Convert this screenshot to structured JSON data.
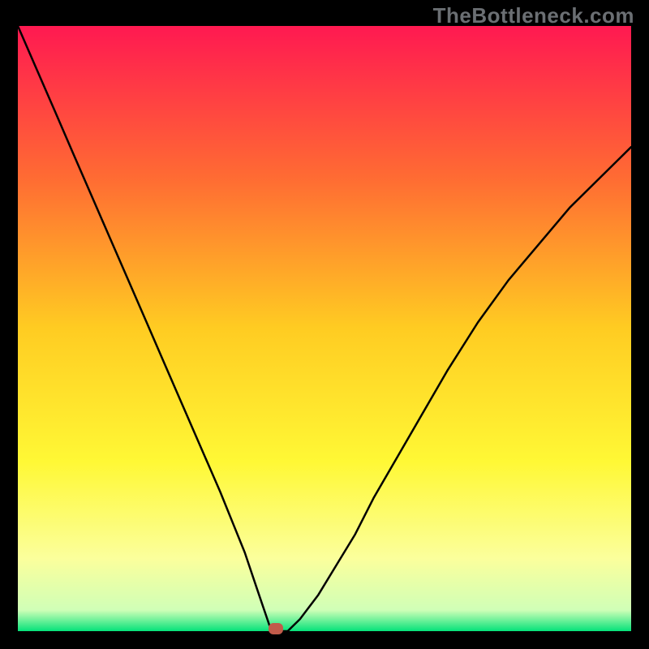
{
  "watermark": "TheBottleneck.com",
  "chart_data": {
    "type": "line",
    "title": "",
    "xlabel": "",
    "ylabel": "",
    "xlim": [
      0,
      100
    ],
    "ylim": [
      0,
      100
    ],
    "grid": false,
    "marker": {
      "x": 42,
      "y": 0,
      "color": "#c25b4a"
    },
    "background_gradient": [
      {
        "pos": 0.0,
        "color": "#ff1951"
      },
      {
        "pos": 0.25,
        "color": "#ff6b33"
      },
      {
        "pos": 0.5,
        "color": "#ffcc22"
      },
      {
        "pos": 0.72,
        "color": "#fff835"
      },
      {
        "pos": 0.88,
        "color": "#fbff9c"
      },
      {
        "pos": 0.965,
        "color": "#d0ffb7"
      },
      {
        "pos": 1.0,
        "color": "#05e27a"
      }
    ],
    "series": [
      {
        "name": "curve",
        "x": [
          0,
          3,
          6,
          9,
          12,
          15,
          18,
          21,
          24,
          27,
          30,
          33,
          35,
          37,
          39,
          40,
          41,
          42,
          43,
          44,
          46,
          49,
          52,
          55,
          58,
          62,
          66,
          70,
          75,
          80,
          85,
          90,
          95,
          100
        ],
        "y": [
          100,
          93,
          86,
          79,
          72,
          65,
          58,
          51,
          44,
          37,
          30,
          23,
          18,
          13,
          7,
          4,
          1,
          0,
          0,
          0,
          2,
          6,
          11,
          16,
          22,
          29,
          36,
          43,
          51,
          58,
          64,
          70,
          75,
          80
        ]
      }
    ]
  }
}
